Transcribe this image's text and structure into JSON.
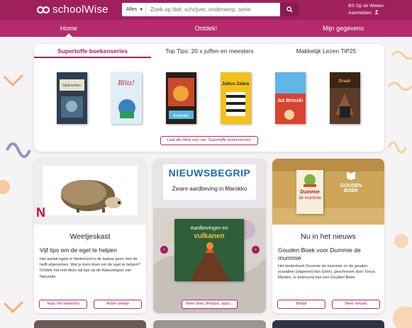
{
  "header": {
    "logo_text": "schoolWise",
    "search": {
      "filter_value": "Alles",
      "placeholder": "Zoek op titel, schrijver, onderwerp, serie"
    },
    "user": {
      "name": "BS Op de Wielen",
      "login_label": "Aanmelden"
    }
  },
  "nav": {
    "items": [
      "Home",
      "Ontdek!",
      "Mijn gegevens"
    ],
    "active_index": 0
  },
  "featured": {
    "tabs": [
      "Supertoffe boekenseries",
      "Top Tips: 20 x juffen en meesters",
      "Makkelijk Lezen TiP25"
    ],
    "active_tab": 0,
    "books": [
      {
        "title": "Opdrachten",
        "bg": "#2c3e4f"
      },
      {
        "title": "Blitz!",
        "bg": "#dfeef7"
      },
      {
        "title": "Kinderdijk",
        "bg": "#2a1f1a"
      },
      {
        "title": "Julius Zebra",
        "bg": "#f2c21b"
      },
      {
        "title": "Jut Brinski",
        "bg": "#d9432f"
      },
      {
        "title": "Draak",
        "bg": "#5b3b28"
      }
    ],
    "all_button": "Laat alle titels zien van 'Supertoffe boekenseries'"
  },
  "cards": {
    "weetjes": {
      "badge": "N",
      "title": "Weetjeskast",
      "heading": "Vijf tips om de egel te helpen",
      "text": "Het aantal egels in Nederland is de laatste jaren met de helft afgenomen. Wat je kunt doen om de egel te helpen? Ontdek het met deze vijf tips op de Natuurwijzer van Naturalis.",
      "btn1": "Naar het antwoord",
      "btn2": "Ander weetje"
    },
    "nieuwsbegrip": {
      "brand": "NIEUWSBEGRIP",
      "headline": "Zware aardbeving in Marokko",
      "book_line1": "Aardbevingen en",
      "book_line2": "vulkanen",
      "btn": "Meer sites, filmpjes, apps..."
    },
    "nieuws": {
      "title": "Nu in het nieuws",
      "heading": "Gouden Boek voor Dummie de mummie",
      "text": "Het kinderboek Dummie de mummie en de gouden scarabee (uitgeverij Van Goor), geschreven door Tosca Menten, is bekroond met een Gouden Boek.",
      "book_line1": "Dummie",
      "book_line2": "de mummie",
      "award_line1": "GOUDEN",
      "award_line2": "BOEK",
      "btn1": "Bekijk",
      "btn2": "Meer nieuws"
    }
  }
}
